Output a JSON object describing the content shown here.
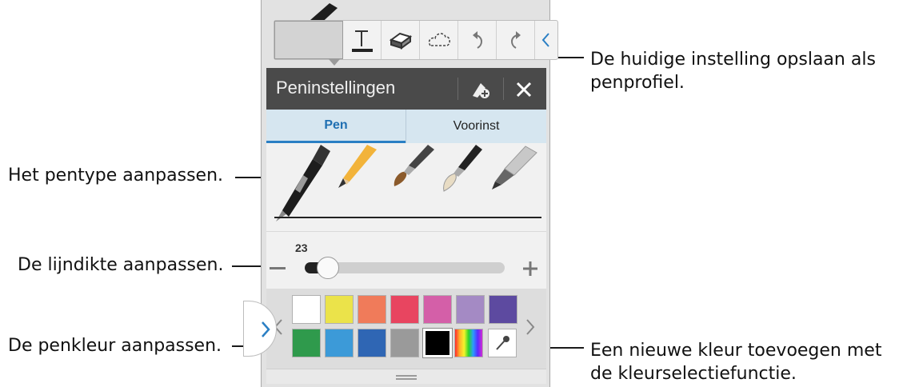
{
  "callouts": {
    "pen_type": "Het pentype aanpassen.",
    "line_width": "De lijndikte aanpassen.",
    "pen_color": "De penkleur aanpassen.",
    "save_profile_line1": "De huidige instelling opslaan als",
    "save_profile_line2": "penprofiel.",
    "new_color_line1": "Een nieuwe kleur toevoegen met",
    "new_color_line2": "de kleurselectiefunctie."
  },
  "panel": {
    "title": "Peninstellingen",
    "tabs": [
      "Pen",
      "Voorinst"
    ]
  },
  "size": {
    "value": "23",
    "fraction": 0.06
  },
  "palette": {
    "row1": [
      "#ffffff",
      "#ebe34a",
      "#f07b5a",
      "#e84560",
      "#d45fa8",
      "#a48ac4",
      "#5d4aa0"
    ],
    "row2": [
      "#2f9a4c",
      "#3c9ad8",
      "#2f66b4",
      "#9a9a9a",
      "#000000"
    ]
  },
  "icons": [
    "pen-tool-icon",
    "text-tool-icon",
    "eraser-icon",
    "lasso-icon",
    "undo-icon",
    "redo-icon",
    "collapse-chevron-icon",
    "save-preset-icon",
    "close-icon",
    "eyedropper-icon",
    "rainbow-spectrum-icon"
  ]
}
